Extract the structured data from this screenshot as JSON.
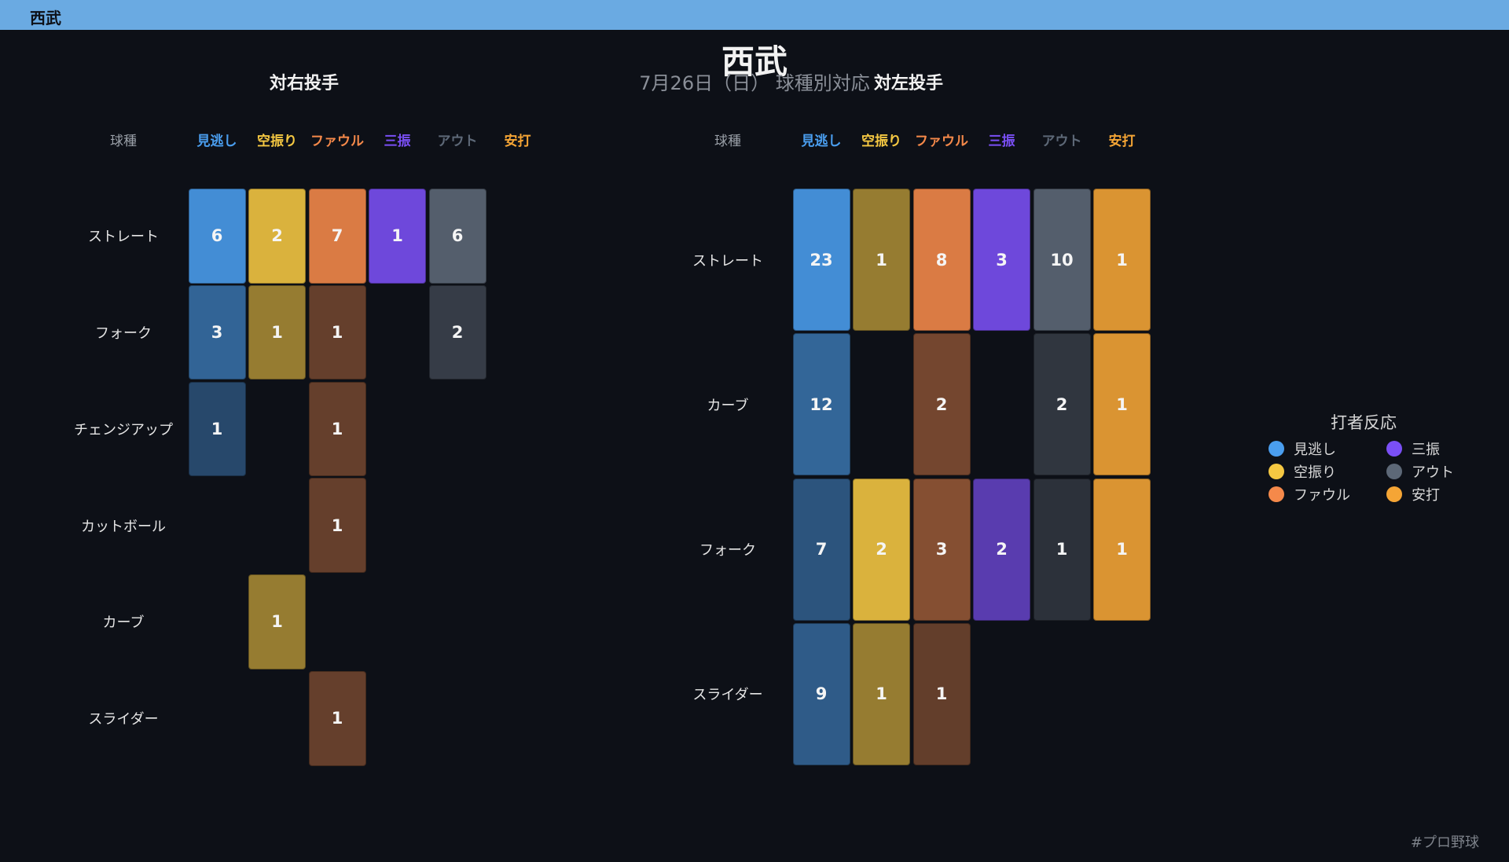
{
  "topbar": {
    "title": "西武"
  },
  "header": {
    "title": "西武",
    "subtitle": "7月26日（日） 球種別対応"
  },
  "colors": {
    "見逃し": "#4a9eef",
    "空振り": "#f5c842",
    "ファウル": "#f5894a",
    "三振": "#7a4ff5",
    "アウト": "#5d6877",
    "安打": "#f5a535"
  },
  "chart_data": [
    {
      "type": "heatmap",
      "title": "対右投手",
      "row_header": "球種",
      "columns": [
        "見逃し",
        "空振り",
        "ファウル",
        "三振",
        "アウト",
        "安打"
      ],
      "rows": [
        "ストレート",
        "フォーク",
        "チェンジアップ",
        "カットボール",
        "カーブ",
        "スライダー"
      ],
      "values": [
        [
          6,
          2,
          7,
          1,
          6,
          null
        ],
        [
          3,
          1,
          1,
          null,
          2,
          null
        ],
        [
          1,
          null,
          1,
          null,
          null,
          null
        ],
        [
          null,
          null,
          1,
          null,
          null,
          null
        ],
        [
          null,
          1,
          null,
          null,
          null,
          null
        ],
        [
          null,
          null,
          1,
          null,
          null,
          null
        ]
      ]
    },
    {
      "type": "heatmap",
      "title": "対左投手",
      "row_header": "球種",
      "columns": [
        "見逃し",
        "空振り",
        "ファウル",
        "三振",
        "アウト",
        "安打"
      ],
      "rows": [
        "ストレート",
        "カーブ",
        "フォーク",
        "スライダー"
      ],
      "values": [
        [
          23,
          1,
          8,
          3,
          10,
          1
        ],
        [
          12,
          null,
          2,
          null,
          2,
          1
        ],
        [
          7,
          2,
          3,
          2,
          1,
          1
        ],
        [
          9,
          1,
          1,
          null,
          null,
          null
        ]
      ]
    }
  ],
  "legend": {
    "title": "打者反応",
    "items": [
      "見逃し",
      "空振り",
      "ファウル",
      "三振",
      "アウト",
      "安打"
    ]
  },
  "footer": {
    "hashtag": "#プロ野球"
  }
}
